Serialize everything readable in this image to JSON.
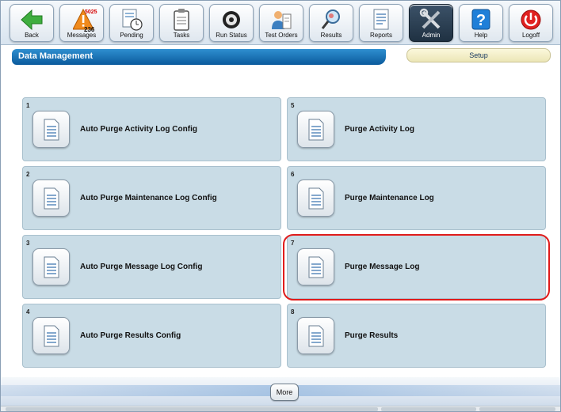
{
  "toolbar": {
    "buttons": [
      {
        "label": "Back",
        "icon": "back-arrow-icon"
      },
      {
        "label": "Messages",
        "icon": "warning-icon",
        "count_top": "5025",
        "count_bottom": "236"
      },
      {
        "label": "Pending",
        "icon": "pending-icon"
      },
      {
        "label": "Tasks",
        "icon": "clipboard-icon"
      },
      {
        "label": "Run Status",
        "icon": "run-status-icon"
      },
      {
        "label": "Test Orders",
        "icon": "test-orders-icon"
      },
      {
        "label": "Results",
        "icon": "results-icon"
      },
      {
        "label": "Reports",
        "icon": "reports-icon"
      },
      {
        "label": "Admin",
        "icon": "tools-icon",
        "active": true
      },
      {
        "label": "Help",
        "icon": "help-icon"
      },
      {
        "label": "Logoff",
        "icon": "power-icon"
      }
    ]
  },
  "header": {
    "title": "Data Management",
    "setup_label": "Setup"
  },
  "tiles": [
    {
      "number": "1",
      "label": "Auto Purge Activity Log Config"
    },
    {
      "number": "2",
      "label": "Auto Purge Maintenance Log Config"
    },
    {
      "number": "3",
      "label": "Auto Purge Message Log Config"
    },
    {
      "number": "4",
      "label": "Auto Purge Results Config"
    },
    {
      "number": "5",
      "label": "Purge Activity Log"
    },
    {
      "number": "6",
      "label": "Purge Maintenance Log"
    },
    {
      "number": "7",
      "label": "Purge Message Log"
    },
    {
      "number": "8",
      "label": "Purge Results"
    }
  ],
  "footer": {
    "more_label": "More"
  },
  "colors": {
    "accent": "#0b5a9c",
    "highlight": "#e01b1b",
    "tile": "#c9dce6"
  }
}
